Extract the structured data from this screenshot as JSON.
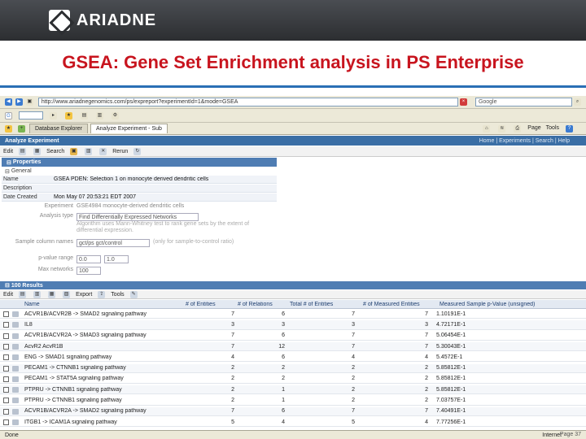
{
  "banner": {
    "logo_text": "ARIADNE"
  },
  "slide": {
    "title": "GSEA: Gene Set Enrichment analysis in PS Enterprise"
  },
  "browser": {
    "address": "http://www.ariadnegenomics.com/ps/expreport?experimentId=1&mode=GSEA",
    "search_placeholder": "Google",
    "tabs": [
      {
        "label": "Database Explorer"
      },
      {
        "label": "Analyze Experiment - Sub"
      }
    ],
    "tab_links": [
      "Page",
      "Tools"
    ]
  },
  "app": {
    "header_title": "Analyze Experiment",
    "header_links": "Home | Experiments | Search | Help",
    "toolbar": {
      "edit": "Edit",
      "search": "Search",
      "rerun": "Rerun"
    },
    "properties_header": "Properties",
    "general_label": "General",
    "properties": [
      {
        "key": "Name",
        "value": "GSEA PDEN: Selection 1 on monocyte derived dendritic cells"
      },
      {
        "key": "Description",
        "value": ""
      },
      {
        "key": "Date Created",
        "value": "Mon May 07 20:53:21 EDT 2007"
      }
    ],
    "form": {
      "experiment_label": "Experiment",
      "experiment_value": "GSE4984 monocyte-derived dendritic cells",
      "analysis_label": "Analysis type",
      "analysis_value": "Find Differentially Expressed Networks",
      "analysis_help": "Algorithm uses Mann-Whitney test to rank gene sets by the extent of differential expression.",
      "sample_label": "Sample column names",
      "sample_value": "gct/ps gct/control",
      "sample_help": "(only for sample-to-control ratio)",
      "pvalue_label": "p-value range",
      "pvalue_from": "0.0",
      "pvalue_to": "1.0",
      "max_label": "Max networks",
      "max_value": "100"
    },
    "results_header": "100 Results",
    "results_toolbar": {
      "edit": "Edit",
      "export": "Export",
      "tools": "Tools"
    },
    "columns": [
      "Name",
      "# of Entities",
      "# of Relations",
      "Total # of Entities",
      "# of Measured Entities",
      "Measured Sample p-Value (unsigned)"
    ],
    "rows": [
      [
        "ACVR1B/ACVR2B -> SMAD2 signaling pathway",
        "7",
        "6",
        "7",
        "7",
        "1.10191E-1"
      ],
      [
        "IL8",
        "3",
        "3",
        "3",
        "3",
        "4.72171E-1"
      ],
      [
        "ACVR1B/ACVR2A -> SMAD3 signaling pathway",
        "7",
        "6",
        "7",
        "7",
        "5.06454E-1"
      ],
      [
        "AcvR2 AcvR1B",
        "7",
        "12",
        "7",
        "7",
        "5.30043E-1"
      ],
      [
        "ENG -> SMAD1 signaling pathway",
        "4",
        "6",
        "4",
        "4",
        "5.4572E-1"
      ],
      [
        "PECAM1 -> CTNNB1 signaling pathway",
        "2",
        "2",
        "2",
        "2",
        "5.85812E-1"
      ],
      [
        "PECAM1 -> STAT5A signaling pathway",
        "2",
        "2",
        "2",
        "2",
        "5.85812E-1"
      ],
      [
        "PTPRU -> CTNNB1 signaling pathway",
        "2",
        "1",
        "2",
        "2",
        "5.85812E-1"
      ],
      [
        "PTPRU -> CTNNB1 signaling pathway",
        "2",
        "1",
        "2",
        "2",
        "7.03757E-1"
      ],
      [
        "ACVR1B/ACVR2A -> SMAD2 signaling pathway",
        "7",
        "6",
        "7",
        "7",
        "7.40491E-1"
      ],
      [
        "ITGB1 -> ICAM1A signaling pathway",
        "5",
        "4",
        "5",
        "4",
        "7.77256E-1"
      ]
    ],
    "status_left": "Done",
    "status_right": "Internet"
  },
  "page_number": "Page 37"
}
